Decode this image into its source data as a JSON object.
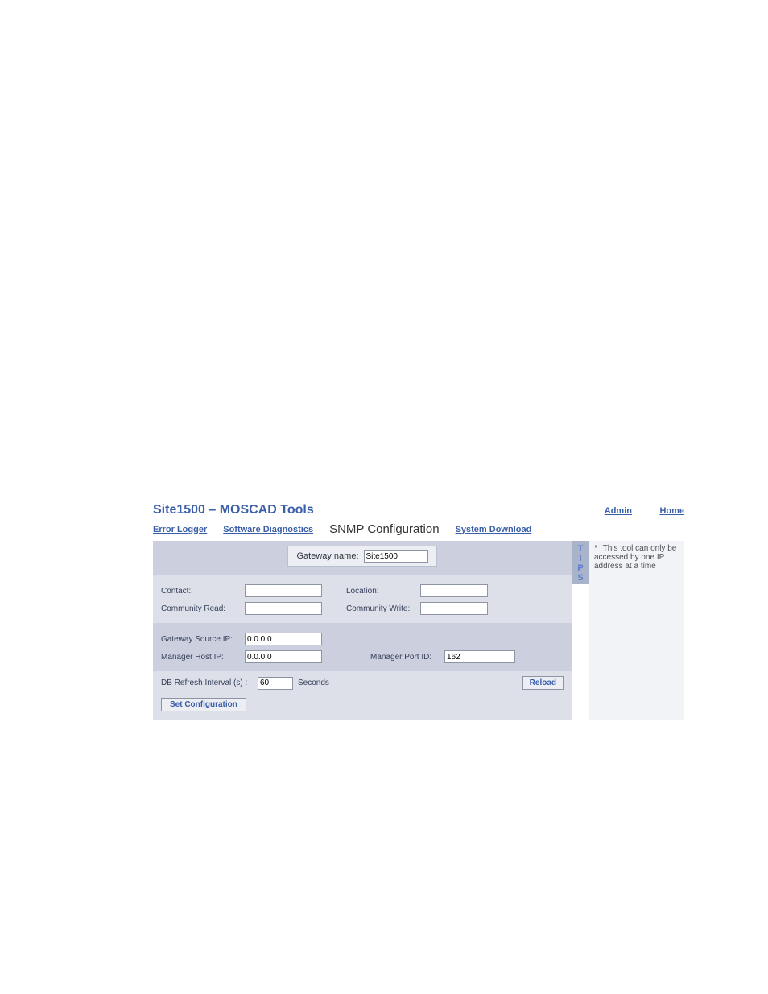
{
  "header": {
    "title": "Site1500 – MOSCAD Tools",
    "admin": "Admin",
    "home": "Home"
  },
  "nav": {
    "error_logger": "Error Logger",
    "software_diagnostics": "Software Diagnostics",
    "snmp_config": "SNMP Configuration",
    "system_download": "System Download"
  },
  "tips": {
    "label": "T\nI\nP\nS",
    "t1": "T",
    "t2": "I",
    "t3": "P",
    "t4": "S",
    "text": "This tool can only be accessed by one IP address at a time"
  },
  "form": {
    "gateway_name_label": "Gateway name:",
    "gateway_name_value": "Site1500",
    "contact_label": "Contact:",
    "contact_value": "",
    "location_label": "Location:",
    "location_value": "",
    "community_read_label": "Community Read:",
    "community_read_value": "",
    "community_write_label": "Community Write:",
    "community_write_value": "",
    "gateway_source_ip_label": "Gateway Source IP:",
    "gateway_source_ip_value": "0.0.0.0",
    "manager_host_ip_label": "Manager Host IP:",
    "manager_host_ip_value": "0.0.0.0",
    "manager_port_id_label": "Manager Port ID:",
    "manager_port_id_value": "162",
    "db_refresh_label": "DB Refresh Interval (s) :",
    "db_refresh_value": "60",
    "db_refresh_unit": "Seconds",
    "reload_btn": "Reload",
    "set_config_btn": "Set Configuration"
  }
}
